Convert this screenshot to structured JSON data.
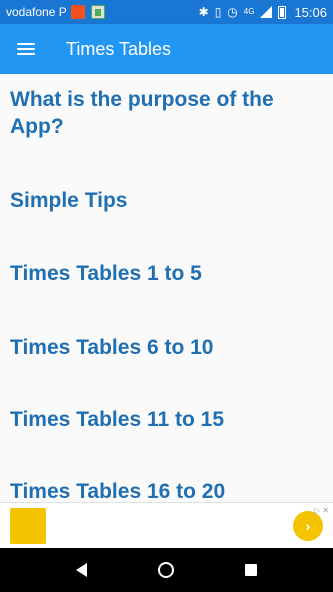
{
  "status_bar": {
    "carrier": "vodafone P",
    "time": "15:06",
    "network_label": "4G",
    "icons": [
      "app-orange-icon",
      "battery-saver-app-icon",
      "bluetooth-icon",
      "vibrate-icon",
      "alarm-icon",
      "signal-icon",
      "battery-icon"
    ]
  },
  "app_bar": {
    "title": "Times Tables",
    "menu_icon": "hamburger-menu-icon"
  },
  "menu": {
    "items": [
      {
        "label": "What is the purpose of the App?"
      },
      {
        "label": "Simple Tips"
      },
      {
        "label": "Times Tables 1 to 5"
      },
      {
        "label": "Times Tables 6 to 10"
      },
      {
        "label": "Times Tables 11 to 15"
      },
      {
        "label": "Times Tables 16 to 20"
      }
    ]
  },
  "colors": {
    "status_bar": "#1976d2",
    "app_bar": "#2196f3",
    "menu_text": "#1f6fb2",
    "ad_accent": "#f5c400"
  },
  "ad": {
    "logo_text": "",
    "text": "",
    "cta_icon": "chevron-right-icon",
    "corner": "▷ ✕"
  },
  "nav_bar": {
    "icons": [
      "back-icon",
      "home-icon",
      "recents-icon"
    ]
  }
}
